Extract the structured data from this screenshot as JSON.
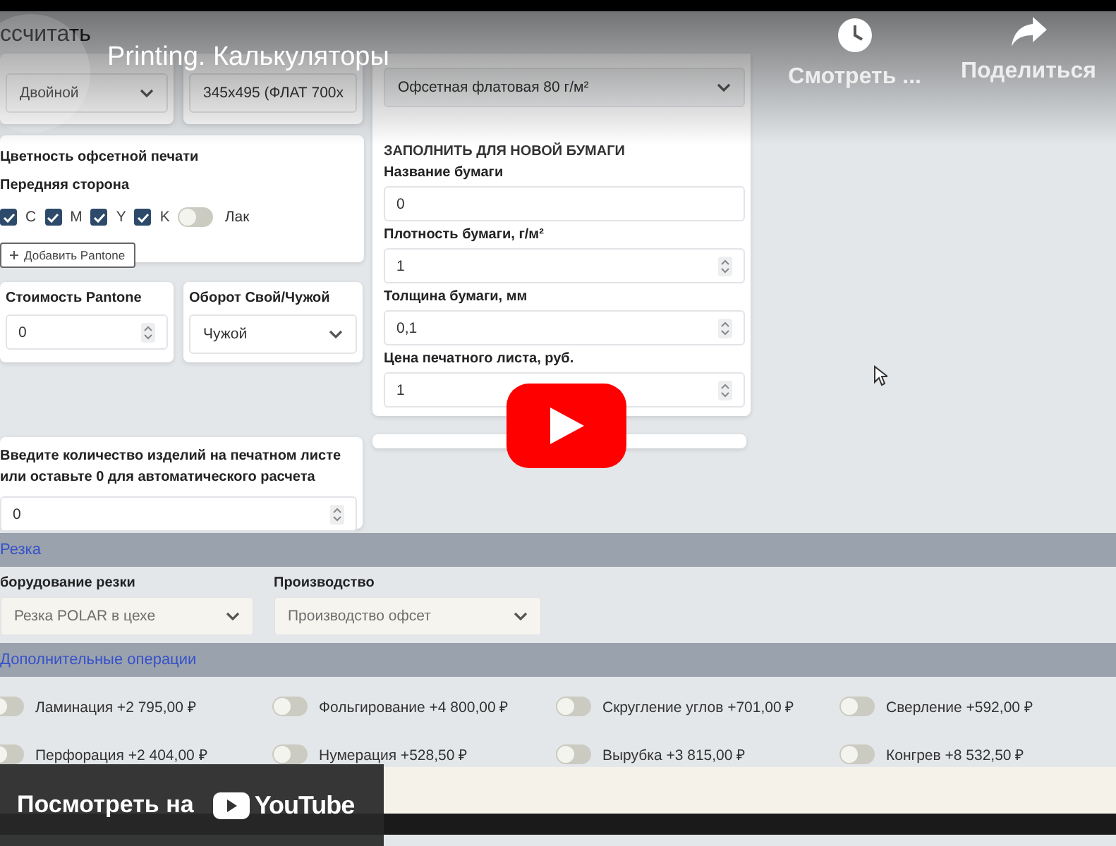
{
  "video": {
    "title": "Printing. Калькуляторы",
    "actions": [
      {
        "kind": "watch_later",
        "label": "Смотреть ..."
      },
      {
        "kind": "share",
        "label": "Поделиться"
      }
    ],
    "watch_on": "Посмотреть на",
    "platform": "YouTube"
  },
  "calculate_button": "ссчитать",
  "top_selects": [
    {
      "value": "Двойной"
    },
    {
      "value": "345x495 (ФЛАТ 700х"
    }
  ],
  "color_card": {
    "title": "Цветность офсетной печати",
    "side": "Передняя сторона",
    "channels": [
      {
        "label": "C",
        "checked": true
      },
      {
        "label": "M",
        "checked": true
      },
      {
        "label": "Y",
        "checked": true
      },
      {
        "label": "K",
        "checked": true
      }
    ],
    "varnish": {
      "label": "Лак",
      "on": false
    },
    "add_button": "Добавить Pantone"
  },
  "pantone": {
    "label": "Стоимость Pantone",
    "value": "0"
  },
  "turnover": {
    "label": "Оборот Свой/Чужой",
    "value": "Чужой"
  },
  "quantity": {
    "label": "Введите количество изделий на печатном листе или оставьте 0 для автоматического расчета",
    "value": "0"
  },
  "paper": {
    "select": "Офсетная флатовая 80 г/м²",
    "heading": "ЗАПОЛНИТЬ ДЛЯ НОВОЙ БУМАГИ",
    "fields": [
      {
        "label": "Название бумаги",
        "value": "0",
        "kind": "text"
      },
      {
        "label": "Плотность бумаги, г/м²",
        "value": "1",
        "kind": "number"
      },
      {
        "label": "Толщина бумаги, мм",
        "value": "0,1",
        "kind": "number"
      },
      {
        "label": "Цена печатного листа, руб.",
        "value": "1",
        "kind": "number"
      }
    ]
  },
  "cutting": {
    "title": "Резка",
    "fields": [
      {
        "label": "борудование резки",
        "value": "Резка POLAR в цехе"
      },
      {
        "label": "Производство",
        "value": "Производство офсет"
      }
    ]
  },
  "extra": {
    "title": "Дополнительные операции",
    "options": [
      {
        "label": "Ламинация +2 795,00 ₽",
        "on": false
      },
      {
        "label": "Фольгирование +4 800,00 ₽",
        "on": false
      },
      {
        "label": "Скругление углов +701,00 ₽",
        "on": false
      },
      {
        "label": "Сверление +592,00 ₽",
        "on": false
      },
      {
        "label": "Перфорация +2 404,00 ₽",
        "on": false
      },
      {
        "label": "Нумерация +528,50 ₽",
        "on": false
      },
      {
        "label": "Вырубка +3 815,00 ₽",
        "on": false
      },
      {
        "label": "Конгрев +8 532,50 ₽",
        "on": false
      }
    ]
  }
}
